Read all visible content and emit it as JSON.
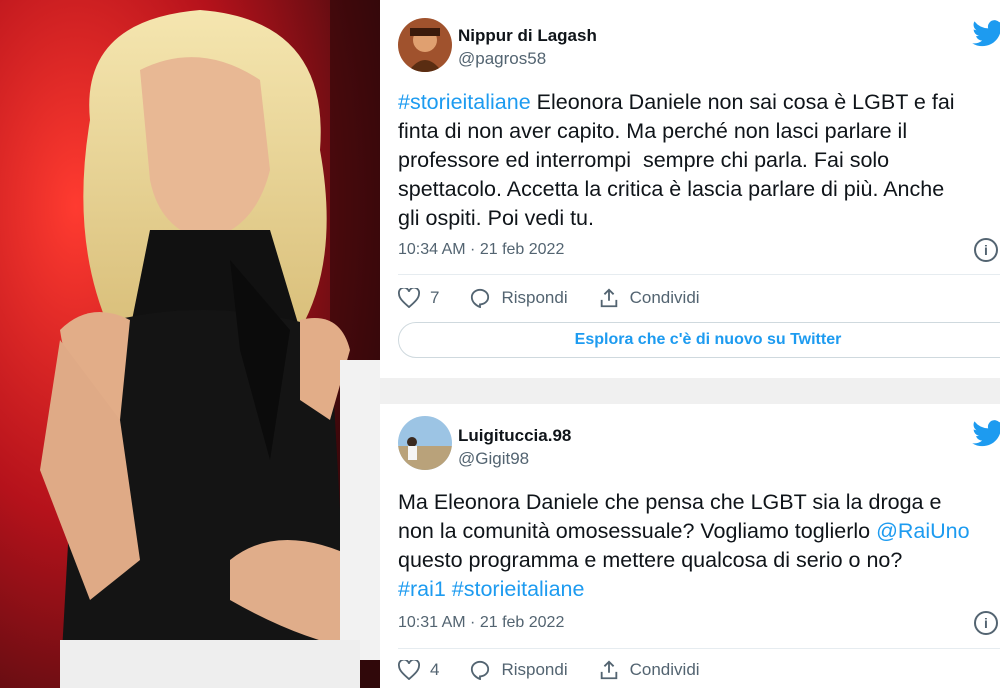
{
  "tweets": [
    {
      "display_name": "Nippur di Lagash",
      "handle": "@pagros58",
      "text_parts": [
        {
          "text": "#storieitaliane",
          "link": true
        },
        {
          "text": " Eleonora Daniele non sai cosa è LGBT e fai\nfinta di non aver capito. Ma perché non lasci parlare il\nprofessore ed interrompi  sempre chi parla. Fai solo\nspettacolo. Accetta la critica è lascia parlare di più. Anche\ngli ospiti. Poi vedi tu.",
          "link": false
        }
      ],
      "timestamp": "10:34 AM · 21 feb 2022",
      "likes": "7",
      "reply_label": "Rispondi",
      "share_label": "Condividi",
      "explore_label": "Esplora che c'è di nuovo su Twitter"
    },
    {
      "display_name": "Luigituccia.98",
      "handle": "@Gigit98",
      "text_parts": [
        {
          "text": "Ma Eleonora Daniele che pensa che LGBT sia la droga e\nnon la comunità omosessuale? Vogliamo toglierlo ",
          "link": false
        },
        {
          "text": "@RaiUno",
          "link": true
        },
        {
          "text": "\nquesto programma e mettere qualcosa di serio o no?\n",
          "link": false
        },
        {
          "text": "#rai1 #storieitaliane",
          "link": true
        }
      ],
      "timestamp": "10:31 AM · 21 feb 2022",
      "likes": "4",
      "reply_label": "Rispondi",
      "share_label": "Condividi"
    }
  ],
  "colors": {
    "accent": "#1d9bf0",
    "text": "#0f1419",
    "muted": "#536471"
  },
  "icons": [
    "twitter-bird-icon",
    "info-icon",
    "heart-icon",
    "reply-icon",
    "share-icon"
  ]
}
